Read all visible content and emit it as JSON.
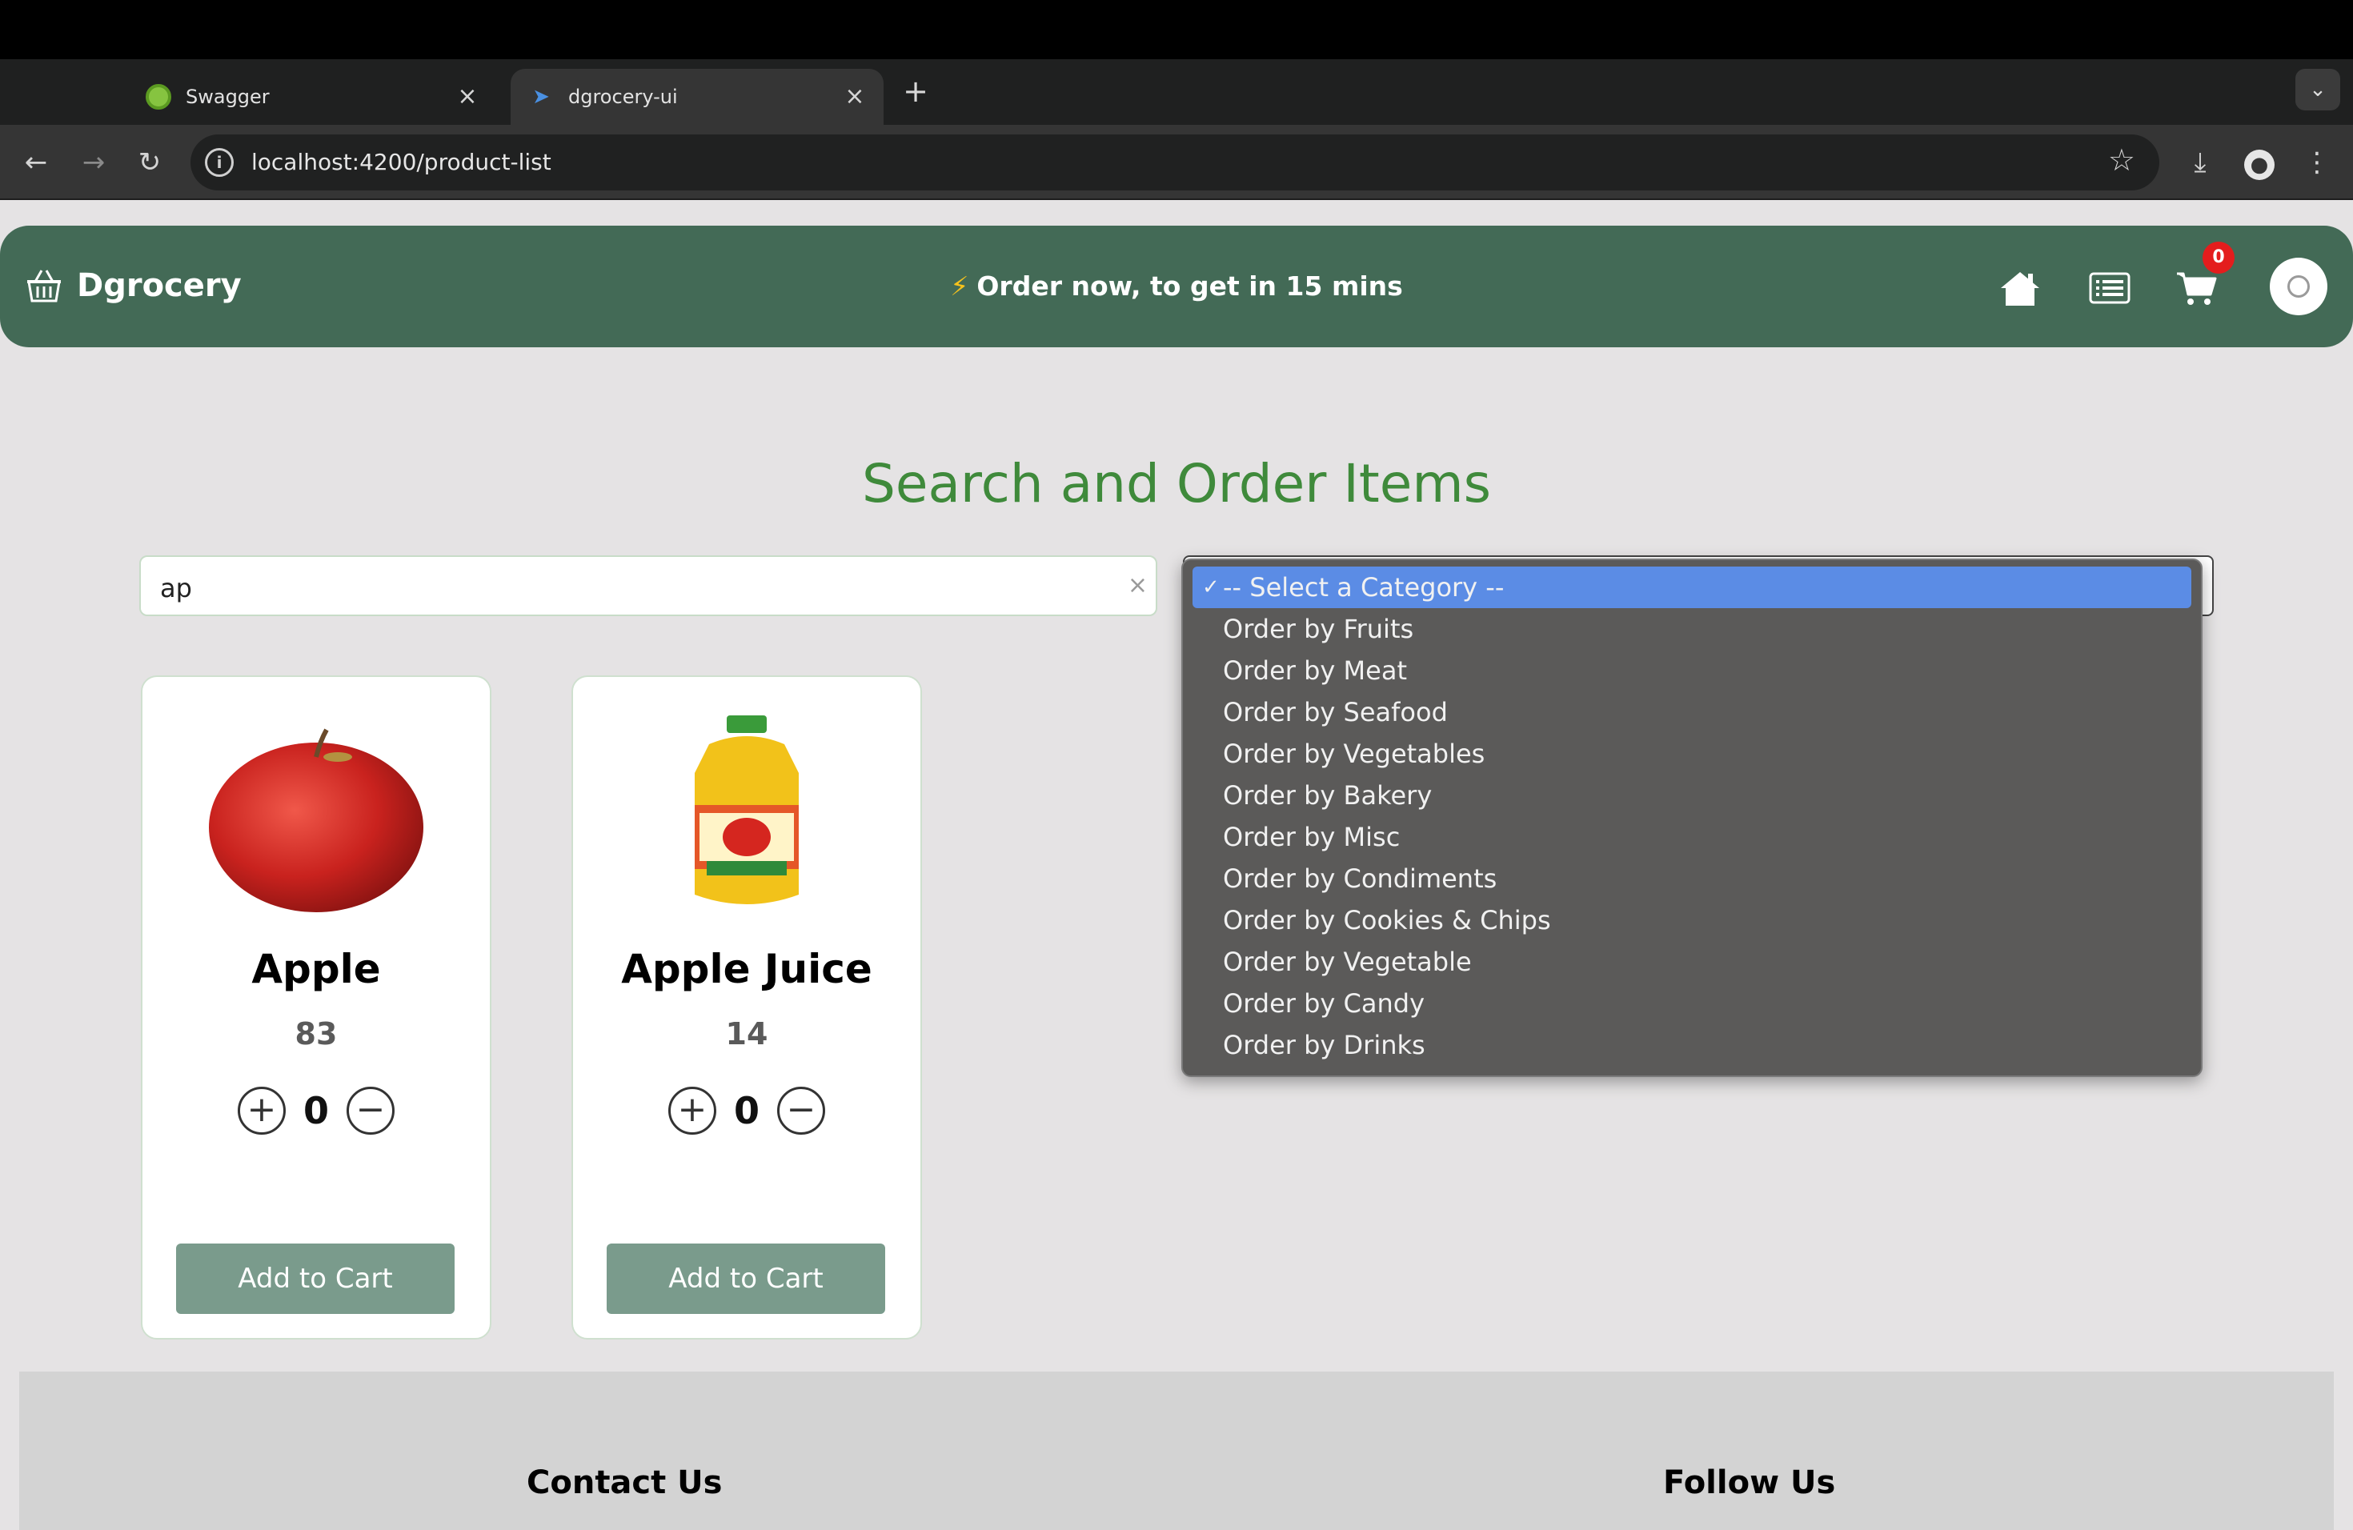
{
  "browser": {
    "tabs": [
      {
        "title": "Swagger",
        "active": false
      },
      {
        "title": "dgrocery-ui",
        "active": true
      }
    ],
    "url": "localhost:4200/product-list"
  },
  "header": {
    "brand": "Dgrocery",
    "promo": "Order now, to get in 15 mins",
    "cart_count": "0",
    "brand_color": "#436a56"
  },
  "main": {
    "heading": "Search and Order Items",
    "search_value": "ap",
    "category": {
      "selected": "-- Select a Category --",
      "options": [
        "-- Select a Category --",
        "Order by Fruits",
        "Order by Meat",
        "Order by Seafood",
        "Order by Vegetables",
        "Order by Bakery",
        "Order by Misc",
        "Order by Condiments",
        "Order by Cookies & Chips",
        "Order by Vegetable",
        "Order by Candy",
        "Order by Drinks"
      ]
    },
    "products": [
      {
        "name": "Apple",
        "stock": "83",
        "quantity": "0",
        "button": "Add to Cart"
      },
      {
        "name": "Apple Juice",
        "stock": "14",
        "quantity": "0",
        "button": "Add to Cart"
      }
    ]
  },
  "footer": {
    "contact": "Contact Us",
    "follow": "Follow Us"
  }
}
